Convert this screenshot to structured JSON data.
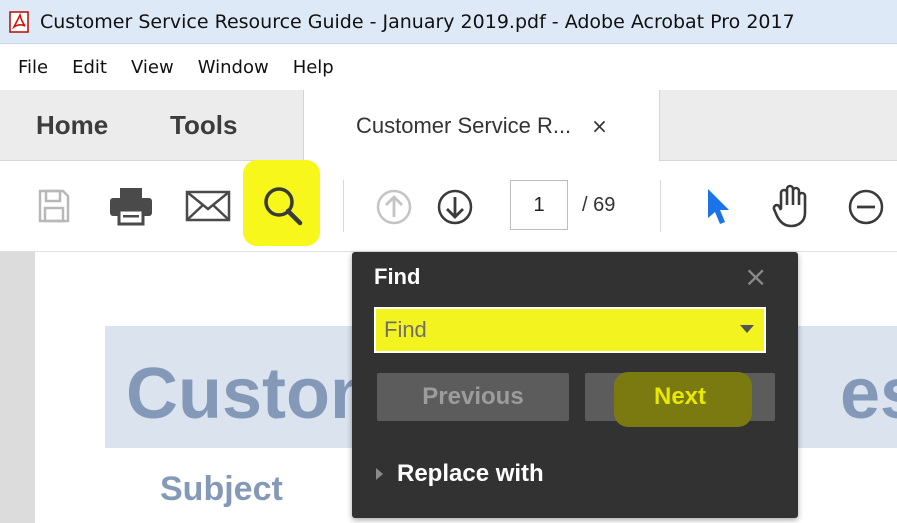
{
  "window": {
    "title": "Customer Service Resource Guide - January 2019.pdf - Adobe Acrobat Pro 2017"
  },
  "menu": {
    "items": [
      "File",
      "Edit",
      "View",
      "Window",
      "Help"
    ]
  },
  "tabs": {
    "home": "Home",
    "tools": "Tools",
    "document": "Customer Service R...",
    "close_glyph": "×"
  },
  "toolbar": {
    "icons": [
      "save-icon",
      "print-icon",
      "email-icon",
      "search-icon",
      "page-up-icon",
      "page-down-icon",
      "select-pointer-icon",
      "hand-tool-icon",
      "zoom-out-icon"
    ],
    "current_page": "1",
    "total_pages": "/ 69",
    "highlight_color": "#f7f71c"
  },
  "document": {
    "title_visible": "Custom",
    "title_right_visible": "eso",
    "subject": "Subject"
  },
  "find_panel": {
    "heading": "Find",
    "close_glyph": "×",
    "input_placeholder": "Find",
    "previous_label": "Previous",
    "next_label": "Next",
    "replace_label": "Replace with"
  }
}
